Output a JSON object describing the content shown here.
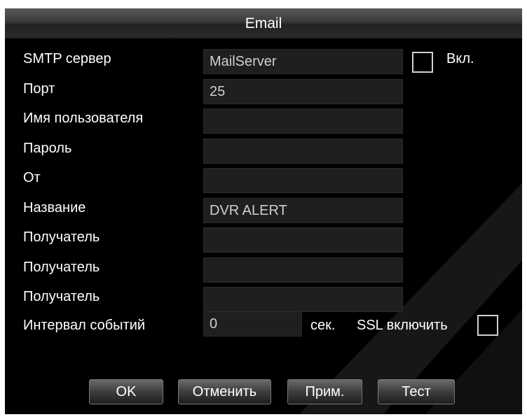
{
  "window": {
    "title": "Email"
  },
  "fields": [
    {
      "label": "SMTP сервер",
      "value": "MailServer"
    },
    {
      "label": "Порт",
      "value": "25"
    },
    {
      "label": "Имя пользователя",
      "value": ""
    },
    {
      "label": "Пароль",
      "value": ""
    },
    {
      "label": "От",
      "value": ""
    },
    {
      "label": "Название",
      "value": "DVR ALERT"
    },
    {
      "label": "Получатель",
      "value": ""
    },
    {
      "label": "Получатель",
      "value": ""
    },
    {
      "label": "Получатель",
      "value": ""
    }
  ],
  "enable": {
    "label": "Вкл.",
    "checked": false
  },
  "interval": {
    "label": "Интервал событий",
    "value": "0",
    "unit": "сек."
  },
  "ssl": {
    "label": "SSL включить",
    "checked": false
  },
  "buttons": {
    "ok": "OK",
    "cancel": "Отменить",
    "apply": "Прим.",
    "test": "Тест"
  }
}
